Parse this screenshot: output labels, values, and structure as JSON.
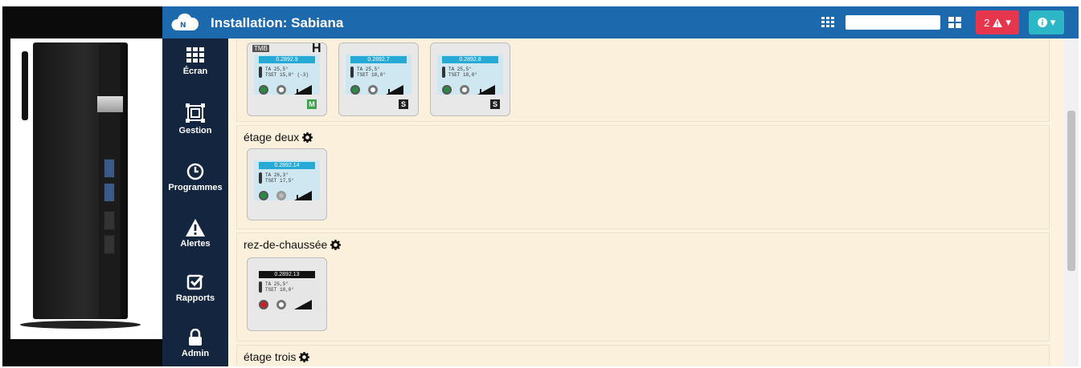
{
  "header": {
    "title": "Installation: Sabiana",
    "alert_count": "2"
  },
  "sidebar": {
    "items": [
      {
        "label": "Écran",
        "icon": "grid-icon"
      },
      {
        "label": "Gestion",
        "icon": "gestion-icon"
      },
      {
        "label": "Programmes",
        "icon": "clock-icon"
      },
      {
        "label": "Alertes",
        "icon": "warning-icon"
      },
      {
        "label": "Rapports",
        "icon": "checkbox-icon"
      },
      {
        "label": "Admin",
        "icon": "lock-icon"
      }
    ]
  },
  "sections": [
    {
      "title": ""
    },
    {
      "title": "étage deux"
    },
    {
      "title": "rez-de-chaussée"
    },
    {
      "title": "étage trois"
    }
  ],
  "cards": {
    "c1": {
      "tag": "TMB",
      "big": "H",
      "code": "0.2892.9",
      "vals": "TA 25,5°\nTSET 15,0° (-3)",
      "badge": "M"
    },
    "c2": {
      "code": "0.2892.7",
      "vals": "TA 25,5°\nTSET 18,0°",
      "badge": "S"
    },
    "c3": {
      "code": "0.2892.8",
      "vals": "TA 25,5°\nTSET 18,0°",
      "badge": "S"
    },
    "c4": {
      "code": "0.2892.14",
      "vals": "TA 26,3°\nTSET 17,5°"
    },
    "c5": {
      "code": "0.2892.13",
      "vals": "TA 25,5°\nTSET 18,0°"
    }
  },
  "colors": {
    "topbar": "#1c69ad",
    "sidebar": "#14263f",
    "main_bg": "#fbf2df",
    "alert": "#e6364d",
    "info": "#2bb7c5"
  }
}
